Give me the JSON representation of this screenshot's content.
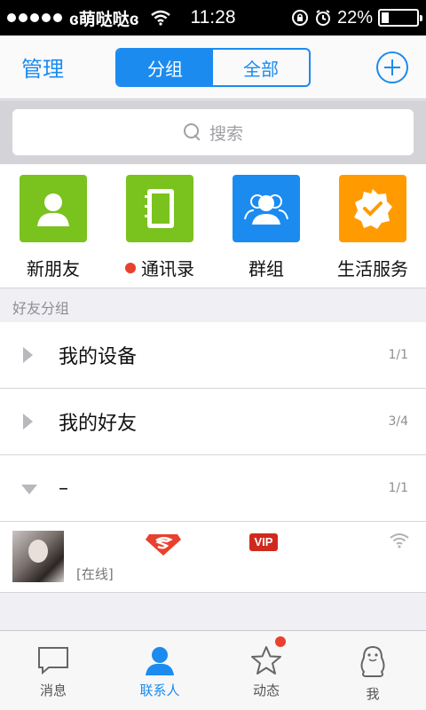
{
  "status_bar": {
    "carrier": "ɞ萌哒哒ɞ",
    "time": "11:28",
    "battery": "22%",
    "battery_level": 0.22
  },
  "nav": {
    "left_label": "管理",
    "segments": [
      "分组",
      "全部"
    ],
    "active_segment": 0
  },
  "search": {
    "placeholder": "搜索"
  },
  "shortcuts": [
    {
      "label": "新朋友",
      "color": "#7ac21e",
      "icon": "new-friend-icon"
    },
    {
      "label": "通讯录",
      "color": "#7ac21e",
      "icon": "address-book-icon",
      "has_red_dot": true
    },
    {
      "label": "群组",
      "color": "#1b8bf0",
      "icon": "group-icon"
    },
    {
      "label": "生活服务",
      "color": "#ff9b00",
      "icon": "service-icon"
    }
  ],
  "section_header": "好友分组",
  "groups": [
    {
      "name": "我的设备",
      "count": "1/1",
      "expanded": false
    },
    {
      "name": "我的好友",
      "count": "3/4",
      "expanded": false
    },
    {
      "name": "–",
      "count": "1/1",
      "expanded": true
    }
  ],
  "friend": {
    "status": "[在线]",
    "vip_label": "VIP"
  },
  "tabs": [
    {
      "label": "消息",
      "icon": "message-icon"
    },
    {
      "label": "联系人",
      "icon": "contacts-icon",
      "active": true
    },
    {
      "label": "动态",
      "icon": "star-icon",
      "has_dot": true
    },
    {
      "label": "我",
      "icon": "penguin-icon"
    }
  ],
  "colors": {
    "accent": "#1b8bf0",
    "green": "#7ac21e",
    "orange": "#ff9b00",
    "red": "#e8412e"
  }
}
